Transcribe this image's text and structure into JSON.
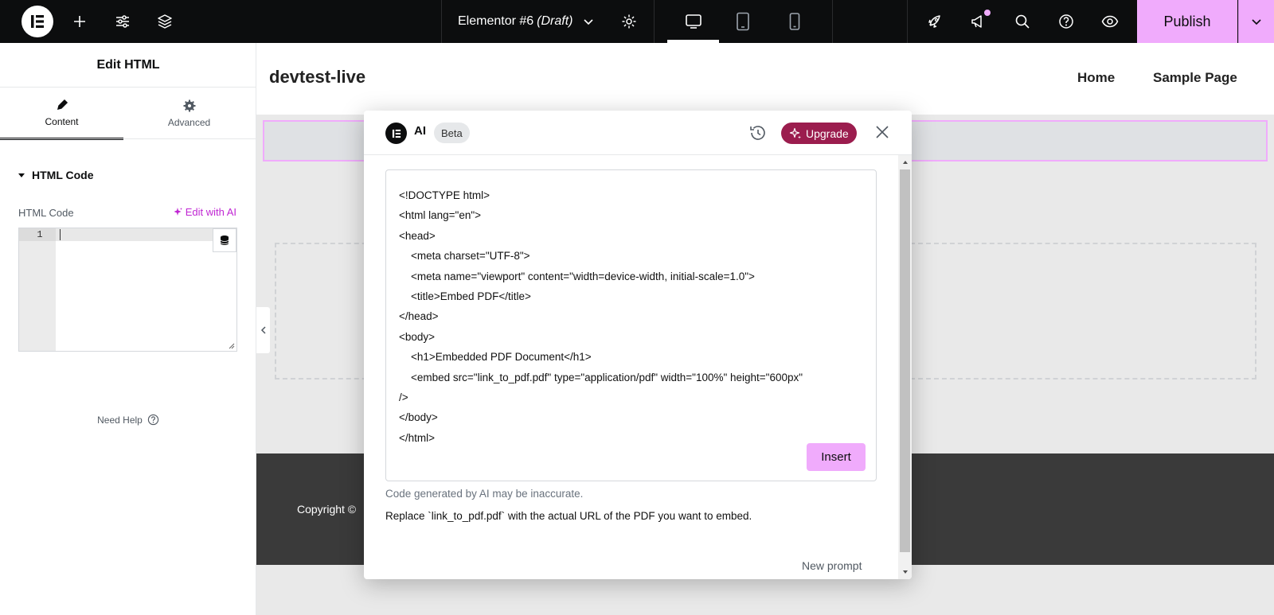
{
  "topbar": {
    "document_name": "Elementor #6",
    "document_status": "(Draft)",
    "publish_label": "Publish",
    "accent_color": "#f0abfc"
  },
  "panel": {
    "title": "Edit HTML",
    "tabs": [
      {
        "label": "Content",
        "icon": "pencil-icon",
        "active": true
      },
      {
        "label": "Advanced",
        "icon": "gear-icon",
        "active": false
      }
    ],
    "section_title": "HTML Code",
    "field_label": "HTML Code",
    "edit_ai_label": "Edit with AI",
    "line_number": "1",
    "need_help": "Need Help"
  },
  "canvas": {
    "site_title": "devtest-live",
    "nav": [
      "Home",
      "Sample Page"
    ],
    "footer_text": "Copyright ©"
  },
  "ai_modal": {
    "title": "AI",
    "badge": "Beta",
    "upgrade_label": "Upgrade",
    "upgrade_color": "#9b1d4e",
    "code": "<!DOCTYPE html>\n<html lang=\"en\">\n<head>\n    <meta charset=\"UTF-8\">\n    <meta name=\"viewport\" content=\"width=device-width, initial-scale=1.0\">\n    <title>Embed PDF</title>\n</head>\n<body>\n    <h1>Embedded PDF Document</h1>\n    <embed src=\"link_to_pdf.pdf\" type=\"application/pdf\" width=\"100%\" height=\"600px\"\n/>\n</body>\n</html>",
    "insert_label": "Insert",
    "disclaimer": "Code generated by AI may be inaccurate.",
    "explanation": "Replace `link_to_pdf.pdf` with the actual URL of the PDF you want to embed.",
    "new_prompt_label": "New prompt"
  }
}
